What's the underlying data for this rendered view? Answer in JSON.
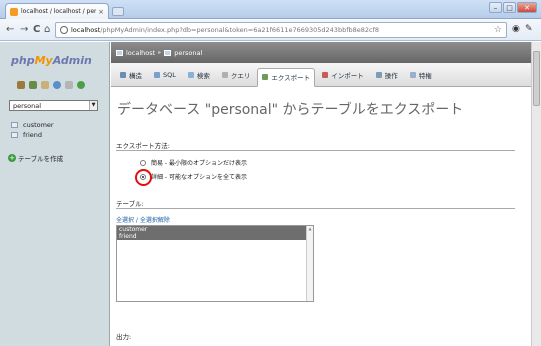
{
  "browser": {
    "tab_title": "localhost / localhost / pers",
    "tab_close": "×",
    "url_host": "localhost",
    "url_path": "/phpMyAdmin/index.php?db=personal&token=6a21f6611e7669305d243bbfb8e82cf8",
    "nav": {
      "back": "←",
      "forward": "→",
      "reload": "C",
      "home": "⌂"
    },
    "win": {
      "minimize": "–",
      "maximize": "□",
      "close": "✕"
    }
  },
  "sidebar": {
    "logo_php": "php",
    "logo_my": "My",
    "logo_admin": "Admin",
    "db_select_value": "personal",
    "tables": [
      "customer",
      "friend"
    ],
    "create_label": "テーブルを作成"
  },
  "main": {
    "breadcrumb": {
      "server": "localhost",
      "db": "personal",
      "sep": "▸"
    },
    "tabs": [
      {
        "label": "構造",
        "icon_color": "#6b8db5"
      },
      {
        "label": "SQL",
        "icon_color": "#7a9fcf"
      },
      {
        "label": "検索",
        "icon_color": "#8ab0d8"
      },
      {
        "label": "クエリ",
        "icon_color": "#b0b0b0"
      },
      {
        "label": "エクスポート",
        "icon_color": "#6f9a5b"
      },
      {
        "label": "インポート",
        "icon_color": "#c85b5b"
      },
      {
        "label": "操作",
        "icon_color": "#7e9bb8"
      },
      {
        "label": "特権",
        "icon_color": "#9ab0c8"
      }
    ],
    "page_title": "データベース \"personal\" からテーブルをエクスポート",
    "export_method_label": "エクスポート方法:",
    "export_options": [
      {
        "label": "簡易 - 最小限のオプションだけ表示",
        "checked": false
      },
      {
        "label": "詳細 - 可能なオプションを全て表示",
        "checked": true
      }
    ],
    "tables_label": "テーブル:",
    "select_all": "全選択",
    "select_sep": " / ",
    "deselect_all": "全選択解除",
    "table_options": [
      "customer",
      "friend"
    ],
    "output_label": "出力:"
  }
}
